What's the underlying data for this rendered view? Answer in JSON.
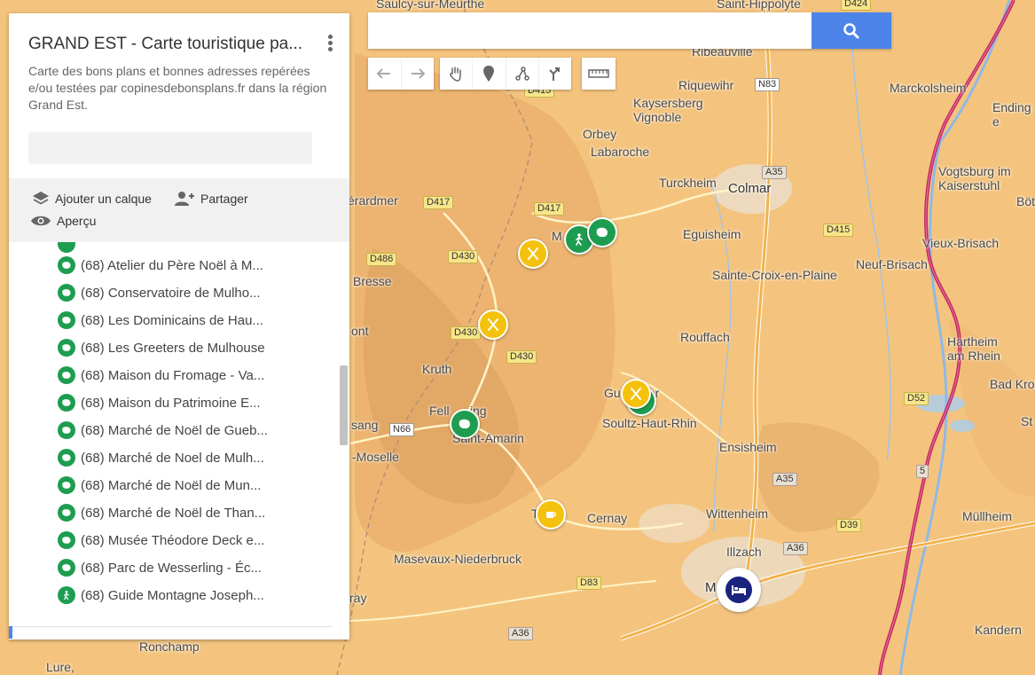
{
  "panel": {
    "title": "GRAND EST - Carte touristique pa...",
    "description": "Carte des bons plans et bonnes adresses repérées e/ou testées par copinesdebonsplans.fr dans la région Grand Est.",
    "add_layer": "Ajouter un calque",
    "share": "Partager",
    "preview": "Aperçu",
    "items": [
      {
        "label": "(68) Atelier du Père Noël à M...",
        "icon": "camera-icon"
      },
      {
        "label": "(68) Conservatoire de Mulho...",
        "icon": "camera-icon"
      },
      {
        "label": "(68) Les Dominicains de Hau...",
        "icon": "camera-icon"
      },
      {
        "label": "(68) Les Greeters de Mulhouse",
        "icon": "camera-icon"
      },
      {
        "label": "(68) Maison du Fromage - Va...",
        "icon": "camera-icon"
      },
      {
        "label": "(68) Maison du Patrimoine E...",
        "icon": "camera-icon"
      },
      {
        "label": "(68) Marché de Noël de Gueb...",
        "icon": "camera-icon"
      },
      {
        "label": "(68) Marché de Noel de Mulh...",
        "icon": "camera-icon"
      },
      {
        "label": "(68) Marché de Noël de Mun...",
        "icon": "camera-icon"
      },
      {
        "label": "(68) Marché de Noël de Than...",
        "icon": "camera-icon"
      },
      {
        "label": "(68) Musée Théodore Deck e...",
        "icon": "camera-icon"
      },
      {
        "label": "(68) Parc de Wesserling - Éc...",
        "icon": "camera-icon"
      },
      {
        "label": "(68) Guide Montagne Joseph...",
        "icon": "hiker-icon"
      }
    ]
  },
  "search": {
    "value": "",
    "placeholder": ""
  },
  "colors": {
    "accent": "#4c84ea",
    "marker_green": "#1e9d50",
    "marker_yellow": "#f4c20d",
    "border_red": "#c2185b"
  },
  "map": {
    "places": {
      "saulcy": "Saulcy-sur-Meurthe",
      "hippolyte": "Saint-Hippolyte",
      "ribeauville": "Ribeauvillé",
      "riquewihr": "Riquewihr",
      "kaysersberg": "Kaysersberg\nVignoble",
      "orbey": "Orbey",
      "labaroche": "Labaroche",
      "turckheim": "Turckheim",
      "colmar": "Colmar",
      "gerardmer": "érardmer",
      "eguisheim": "Eguisheim",
      "sainte_croix": "Sainte-Croix-en-Plaine",
      "bresse": "Bresse",
      "rouffach": "Rouffach",
      "kruth": "Kruth",
      "guebwiller": "Gu        er",
      "soultz": "Soultz-Haut-Rhin",
      "fellering": "Fell      ing",
      "saint_amarin": "Saint-Amarin",
      "ensisheim": "Ensisheim",
      "moselle": "-Moselle",
      "sang": "sang",
      "ont": "ont",
      "thann": "T",
      "cernay": "Cernay",
      "wittenheim": "Wittenheim",
      "masevaux": "Masevaux-Niederbruck",
      "illzach": "Illzach",
      "mulhouse": "M",
      "ronchamp": "Ronchamp",
      "lure": "Lure,",
      "marckolsheim": "Marckolsheim",
      "endingen": "Ending\ne",
      "vogtsburg": "Vogtsburg im\nKaiserstuhl",
      "botz": "Bötz",
      "vieux_brisach": "Vieux-Brisach",
      "neuf_brisach": "Neuf-Brisach",
      "hartheim": "Hartheim\nam Rhein",
      "bad_kroz": "Bad Kroz",
      "st": "St",
      "mullheim": "Müllheim",
      "kandern": "Kandern",
      "ray": "ray",
      "m_munster": "M"
    },
    "roads": {
      "d415a": "D415",
      "n83": "N83",
      "a35a": "A35",
      "d417a": "D417",
      "d417b": "D417",
      "d415b": "D415",
      "d486": "D486",
      "d430a": "D430",
      "d430b": "D430",
      "d430c": "D430",
      "n66": "N66",
      "d52": "D52",
      "a35b": "A35",
      "d39": "D39",
      "a36a": "A36",
      "d83": "D83",
      "a36b": "A36",
      "d424": "D424",
      "a5": "5"
    }
  }
}
